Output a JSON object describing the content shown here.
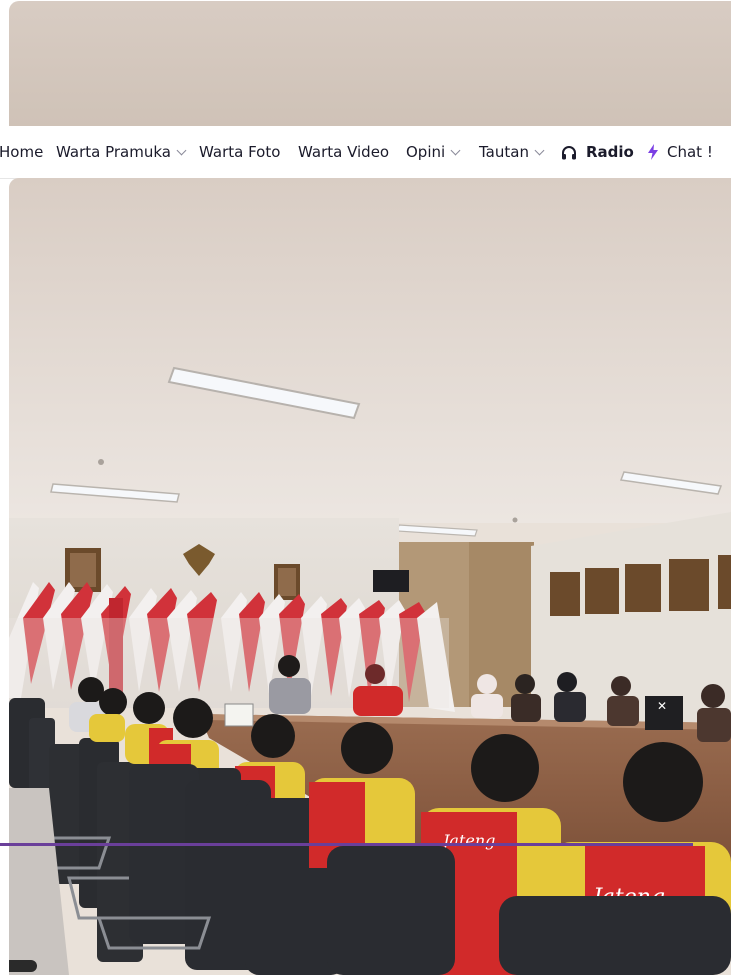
{
  "nav": {
    "items": [
      {
        "label": "Home"
      },
      {
        "label": "Warta Pramuka",
        "dropdown": true
      },
      {
        "label": "Warta Foto"
      },
      {
        "label": "Warta Video"
      },
      {
        "label": "Opini",
        "dropdown": true
      },
      {
        "label": "Tautan",
        "dropdown": true
      },
      {
        "label": "Radio",
        "icon": "headphones-icon"
      },
      {
        "label": "Chat !",
        "icon": "lightning-icon"
      }
    ]
  },
  "photo": {
    "shirt_text": "Jateng"
  },
  "colors": {
    "nav_text": "#1b1b2b",
    "accent_purple": "#6a3f9a",
    "bolt": "#7b3fe4"
  }
}
